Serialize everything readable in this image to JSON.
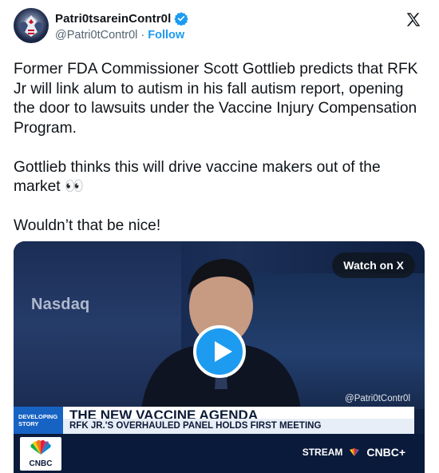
{
  "author": {
    "display_name": "Patri0tsareinContr0l",
    "handle": "@Patri0tContr0l",
    "separator": "·",
    "follow_label": "Follow",
    "verified": true,
    "avatar_icon": "eagle-avatar-icon"
  },
  "platform_icon": "x-logo-icon",
  "tweet": {
    "paragraphs": [
      "Former FDA Commissioner Scott Gottlieb predicts that RFK Jr will link alum to autism in his fall autism report, opening the door to lawsuits under the Vaccine Injury Compensation Program.",
      "Gottlieb thinks this will drive vaccine makers out of the market 👀",
      "Wouldn’t that be nice!"
    ]
  },
  "video": {
    "watch_label": "Watch on X",
    "watermark": "@Patri0tContr0l",
    "background_logo": "Nasdaq",
    "chyron": {
      "tag": "DEVELOPING STORY",
      "headline": "THE NEW VACCINE AGENDA",
      "subheadline": "RFK JR.'S OVERHAULED PANEL HOLDS FIRST MEETING"
    },
    "network_logo": "CNBC",
    "stream_label": "STREAM",
    "stream_brand": "CNBC+"
  },
  "colors": {
    "accent": "#1d9bf0",
    "text": "#0f1419",
    "secondary_text": "#536471",
    "chyron_blue": "#1763c4",
    "ticker_navy": "#0a1a3a"
  }
}
